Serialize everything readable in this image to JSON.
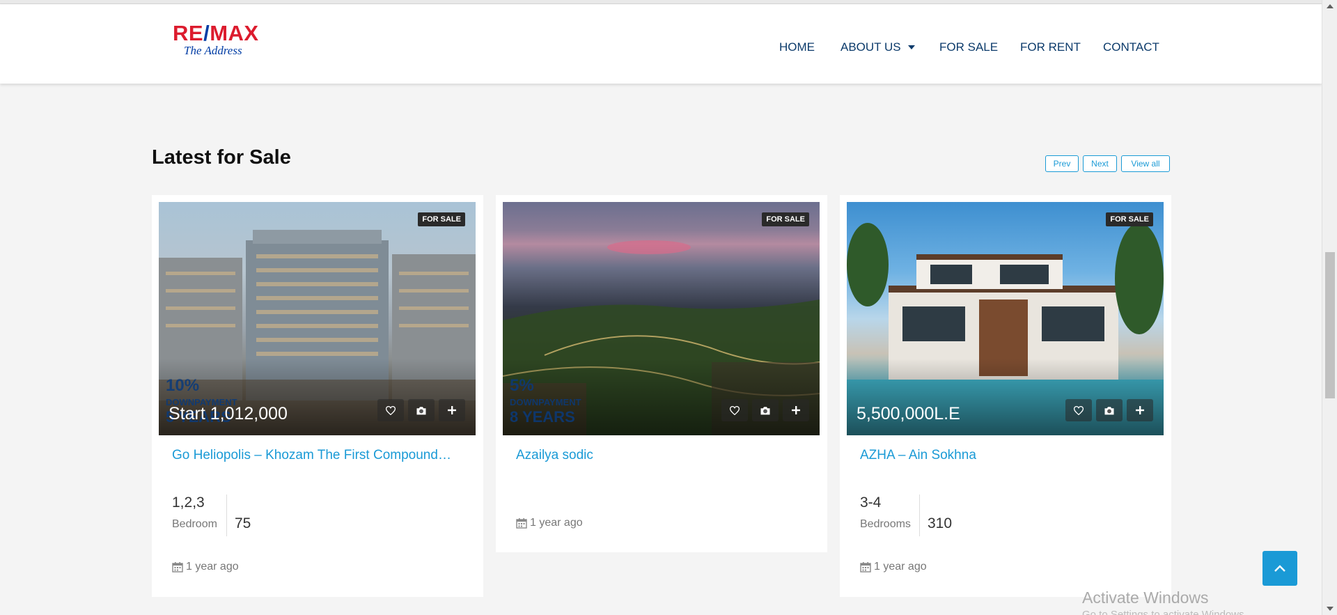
{
  "logo": {
    "brand_left": "RE",
    "brand_slash": "/",
    "brand_right": "MAX",
    "tagline": "The Address"
  },
  "nav": {
    "home": "HOME",
    "about": "ABOUT US",
    "for_sale": "FOR SALE",
    "for_rent": "FOR RENT",
    "contact": "CONTACT"
  },
  "section": {
    "title": "Latest for Sale"
  },
  "pager": {
    "prev": "Prev",
    "next": "Next",
    "view_all": "View all"
  },
  "cards": [
    {
      "badge": "FOR SALE",
      "price": "Start 1,012,000",
      "promo_pct": "10%",
      "promo_line1": "DOWNPAYMENT",
      "promo_line2": "5 YEARS",
      "title": "Go Heliopolis – Khozam The First Compound…",
      "bedrooms": "1,2,3",
      "bedrooms_label": "Bedroom",
      "area": "75",
      "date": "1 year ago"
    },
    {
      "badge": "FOR SALE",
      "promo_pct": "5%",
      "promo_line1": "DOWNPAYMENT",
      "promo_line2": "8 YEARS",
      "title": "Azailya sodic",
      "date": "1 year ago"
    },
    {
      "badge": "FOR SALE",
      "price": "5,500,000L.E",
      "title": "AZHA – Ain Sokhna",
      "bedrooms": "3-4",
      "bedrooms_label": "Bedrooms",
      "area": "310",
      "date": "1 year ago"
    }
  ],
  "watermark": {
    "line1": "Activate Windows",
    "line2": "Go to Settings to activate Windows."
  },
  "colors": {
    "accent": "#1a9ad6",
    "nav": "#0c3b6b",
    "brand_red": "#dc1c2e",
    "brand_blue": "#003da5"
  }
}
